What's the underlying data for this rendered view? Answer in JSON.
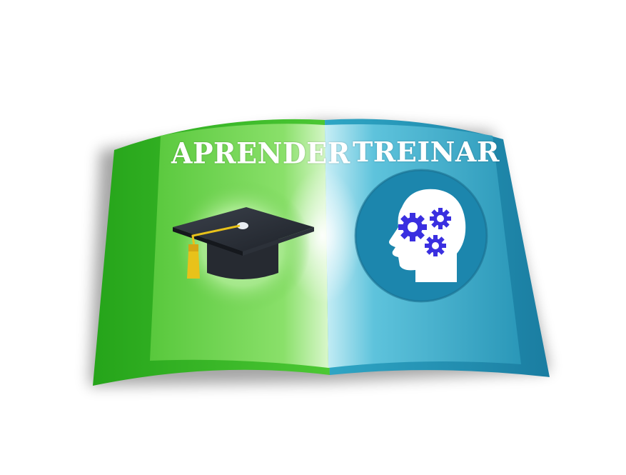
{
  "book": {
    "left_page": {
      "title": "APRENDER",
      "icon": "graduation-cap-icon",
      "color": "#3dbb2a"
    },
    "right_page": {
      "title": "TREINAR",
      "icon": "head-gears-icon",
      "color": "#1c8fb0"
    }
  },
  "colors": {
    "green": "#3dbb2a",
    "light_green": "#a8ec8c",
    "teal": "#1c8fb0",
    "circle_blue": "#1a7fa8",
    "gear_blue": "#3a2fe0",
    "tassel_yellow": "#e8c21a",
    "cap_dark": "#2a2f38"
  }
}
